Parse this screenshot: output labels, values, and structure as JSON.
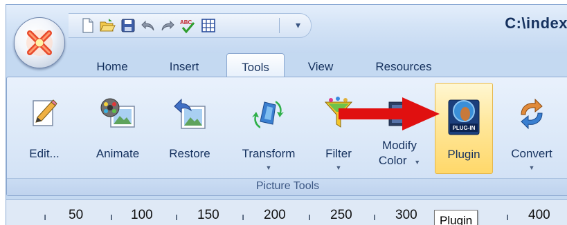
{
  "window": {
    "title": "C:\\index"
  },
  "quick_access": {
    "icons": [
      "new-file-icon",
      "open-folder-icon",
      "save-icon",
      "undo-icon",
      "redo-icon",
      "spellcheck-icon",
      "table-icon"
    ],
    "chevron": "▾"
  },
  "tabs": [
    {
      "label": "Home"
    },
    {
      "label": "Insert"
    },
    {
      "label": "Tools",
      "active": true
    },
    {
      "label": "View"
    },
    {
      "label": "Resources"
    }
  ],
  "tools": [
    {
      "label": "Edit...",
      "icon": "edit-pencil-icon"
    },
    {
      "label": "Animate",
      "icon": "film-reel-icon"
    },
    {
      "label": "Restore",
      "icon": "restore-image-icon"
    },
    {
      "label": "Transform",
      "icon": "transform-icon",
      "has_menu": true,
      "caret": "▼"
    },
    {
      "label": "Filter",
      "icon": "funnel-icon",
      "has_menu": true,
      "caret": "▼"
    },
    {
      "label_line1": "Modify",
      "label_line2": "Color",
      "icon": "modify-color-icon",
      "has_menu": true,
      "caret": "▼"
    },
    {
      "label": "Plugin",
      "icon": "plugin-icon",
      "highlighted": true,
      "badge": "PLUG-IN"
    },
    {
      "label": "Convert",
      "icon": "convert-arrows-icon",
      "has_menu": true,
      "caret": "▼"
    }
  ],
  "group": {
    "label": "Picture Tools"
  },
  "ruler": {
    "marks": [
      "50",
      "100",
      "150",
      "200",
      "250",
      "300",
      "400"
    ]
  },
  "tooltip": {
    "text": "Plugin"
  },
  "colors": {
    "annotation_arrow": "#e01010",
    "ribbon_highlight": "#ffe79b",
    "text": "#15315e"
  }
}
